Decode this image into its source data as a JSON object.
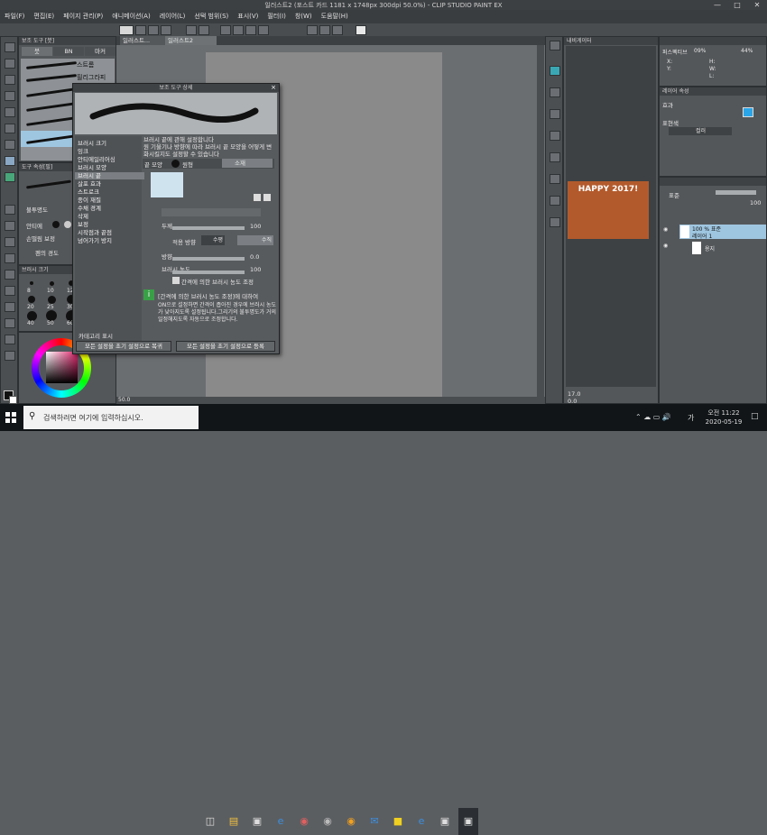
{
  "window": {
    "title": "일러스트2 (포스트 카드 1181 x 1748px 300dpi 50.0%)  - CLIP STUDIO PAINT EX"
  },
  "menu": [
    "파일(F)",
    "편집(E)",
    "페이지 관리(P)",
    "애니메이션(A)",
    "레이어(L)",
    "선택 범위(S)",
    "표시(V)",
    "필터(I)",
    "창(W)",
    "도움말(H)"
  ],
  "subtool_panel": {
    "title": "보조 도구 [붓]",
    "tabs": [
      "붓",
      "BN",
      "마커"
    ],
    "items": [
      "스트롬",
      "필리그라피"
    ]
  },
  "tool_property": {
    "title": "도구 속성[필]",
    "labels": [
      "불투명도",
      "안티에",
      "손떨림 보정",
      "펜의 경도"
    ]
  },
  "brush_size_panel": {
    "title": "브러시 크기",
    "sizes": [
      "8",
      "10",
      "12",
      "20",
      "25",
      "30",
      "40",
      "50",
      "60"
    ]
  },
  "colors": {
    "accent": "#9fc6e0"
  },
  "canvas_tabs": [
    "일러스트...",
    "일러스트2"
  ],
  "dialog": {
    "title": "보조 도구 상세",
    "categories": [
      "브러시 크기",
      "잉크",
      "안티에일리어싱",
      "브러시 모양",
      "브러시 끝",
      "살포 효과",
      "스트로크",
      "종이 재질",
      "수채 경계",
      "삭제",
      "보정",
      "시작점과 끝점",
      "넘어가기 방지"
    ],
    "selected_category": "브러시 끝",
    "description": "브러시 끝에 관해 설정합니다\n원 기울기나 방향에 따라 브러시 끝 모양을 어떻게 변화시킬지도 설정할 수 있습니다",
    "tip_section": "끝 모양",
    "tip_options": [
      "원형",
      "소재"
    ],
    "fields": {
      "thickness_label": "두께",
      "thickness_value": "100",
      "apply_direction_label": "적용 방향",
      "apply_direction_options": [
        "수평",
        "수직"
      ],
      "direction_label": "방향",
      "direction_value": "0.0",
      "density_label": "브러시 농도",
      "density_value": "100",
      "adjust_check": "간격에 의한 브러시 농도 조정"
    },
    "info_title": "[간격에 의한 브러시 농도 조정]에 대하여",
    "info_text": "ON으로 설정하면 간격이 좁아진 경우에 브러시 농도가 낮아지도록 설정됩니다.그리기의 불투명도가 거의 일정해지도록 자동으로 조정합니다.",
    "show_category": "카테고리 표시",
    "buttons": [
      "모든 설정을 초기 설정으로 복귀",
      "모든 설정을 초기 설정으로 등록"
    ]
  },
  "navigator": {
    "tab": "내비게이터",
    "zoom": "17.0",
    "angle": "0.0"
  },
  "preview_text": "HAPPY 2017!",
  "info_panel": {
    "label": "퍼스펙티브",
    "zoom": "09%",
    "rotation": "44%",
    "x": "X:",
    "y": "Y:",
    "h": "H:",
    "w": "W:",
    "l": "L:"
  },
  "layer_property": {
    "title": "레이어 속성",
    "effect": "효과",
    "display_color": "표현색",
    "color_value": "컬러"
  },
  "layers": {
    "blend": "표준",
    "opacity": "100",
    "items": [
      {
        "name": "100 % 표준",
        "sub": "레이어 1"
      },
      {
        "name": "용지"
      }
    ]
  },
  "zoom_bottom": "50.0",
  "taskbar": {
    "search_placeholder": "검색하려면 여기에 입력하십시오.",
    "time": "오전 11:22",
    "date": "2020-05-19",
    "ime": "가"
  }
}
